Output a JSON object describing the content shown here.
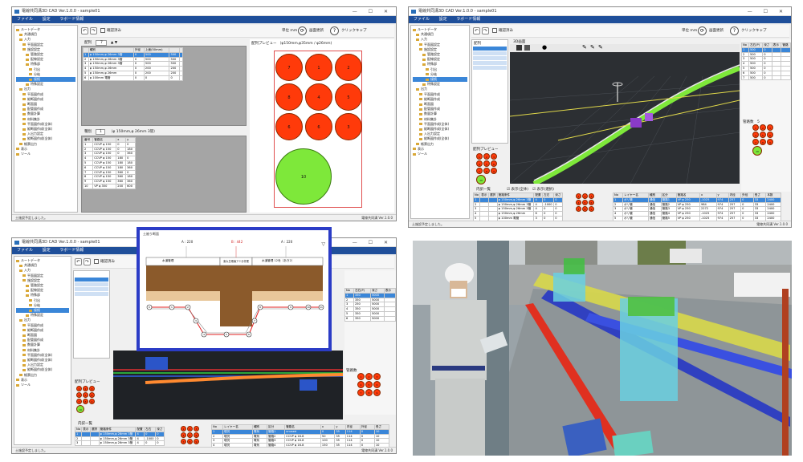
{
  "app": {
    "title": "電線共同溝3D CAD Ver.1.0.0 - sample01",
    "menu": [
      "ファイル",
      "設定",
      "ラボード情報"
    ],
    "status_left": "土施設予定しました。",
    "status_right": "電線共同溝 Ver.1.0.0"
  },
  "toolbar": {
    "checkbox_label": "確認済み",
    "unit_label": "単位 mm",
    "update_label": "画面更新",
    "check_label": "クリックキャプ",
    "prev_icon": "undo-icon",
    "next_icon": "redo-icon"
  },
  "tree": {
    "items": [
      "ルートデータ",
      "共通項目",
      "入力",
      "平面図設定",
      "施設設定",
      "管路設定",
      "配線設定",
      "特殊部",
      "引出",
      "分岐",
      "接続",
      "特殊設定",
      "出力",
      "平面図作成",
      "縦断図作成",
      "断面図",
      "配管図作成",
      "数量計算",
      "材料集計",
      "平面図作成(全体)",
      "縦断図作成(全体)",
      "入出力設定",
      "縦断図作成(全体)",
      "帳票出力",
      "表示",
      "ツール"
    ],
    "selected_index": 10
  },
  "q1": {
    "rack_label": "配列",
    "rack_value": "7",
    "preview_title": "配列プレビュー （φ150mm,φ35mm / φ26mm)",
    "table1_headers": [
      "",
      "種別",
      "外径",
      "上面(50mm)",
      "",
      ""
    ],
    "table1_rows": [
      [
        "1",
        "φ 150mm,φ 26mm 3管",
        "0",
        "500",
        "500",
        ""
      ],
      [
        "2",
        "φ 150mm,φ 26mm 3管",
        "0",
        "500",
        "500",
        ""
      ],
      [
        "3",
        "φ 150mm,φ 26mm 3管",
        "0",
        "500",
        "500",
        ""
      ],
      [
        "4",
        "φ 150mm,φ 26mm",
        "0",
        "200",
        "200",
        ""
      ],
      [
        "5",
        "φ 150mm,φ 26mm",
        "0",
        "200",
        "200",
        ""
      ],
      [
        "6",
        "φ 100mm 電管",
        "0",
        "0",
        "0",
        ""
      ]
    ],
    "sub_label": "種別",
    "sub_value": "1",
    "sub_caption": "（φ 150mm,φ 26mm 3管）",
    "table2_headers": [
      "番号",
      "管路名",
      "x",
      "y"
    ],
    "table2_rows": [
      [
        "1",
        "CCVP φ 150",
        "0",
        "0"
      ],
      [
        "2",
        "CCVP φ 150",
        "0",
        "180"
      ],
      [
        "3",
        "CCVP φ 150",
        "0",
        "360"
      ],
      [
        "4",
        "CCVP φ 150",
        "180",
        "0"
      ],
      [
        "5",
        "CCVP φ 150",
        "180",
        "180"
      ],
      [
        "6",
        "CCVP φ 150",
        "180",
        "360"
      ],
      [
        "7",
        "CCVP φ 150",
        "360",
        "0"
      ],
      [
        "8",
        "CCVP φ 150",
        "360",
        "180"
      ],
      [
        "9",
        "CCVP φ 150",
        "360",
        "360"
      ],
      [
        "10",
        "VP φ 350",
        "200",
        "600"
      ]
    ],
    "circle_labels": [
      "7",
      "1",
      "2",
      "8",
      "4",
      "5",
      "6",
      "6",
      "3"
    ],
    "big_circle_label": "10"
  },
  "q2": {
    "rack_label": "配列",
    "view_label": "3D画面",
    "preview_label": "配列プレビュー",
    "right_headers": [
      "No",
      "左右(P)",
      "深さ",
      "表示",
      "管路"
    ],
    "right_rows": [
      [
        "1",
        "500",
        "0",
        "",
        ""
      ],
      [
        "2",
        "500",
        "0",
        "",
        ""
      ],
      [
        "3",
        "500",
        "0",
        "",
        ""
      ],
      [
        "4",
        "500",
        "0",
        "",
        ""
      ],
      [
        "5",
        "500",
        "0",
        "",
        ""
      ],
      [
        "6",
        "500",
        "0",
        "",
        ""
      ],
      [
        "7",
        "500",
        "0",
        "",
        ""
      ]
    ],
    "check_all": "表示(全体)",
    "check_sel": "表示(選択)",
    "bottom_label": "内訳一覧",
    "bottom_headers": [
      "No",
      "表示",
      "選択",
      "管路条件",
      "配置",
      "左右",
      "深さ"
    ],
    "bottom_rows": [
      [
        "1",
        "",
        "",
        "φ 150mm,φ 26mm 3管",
        "4",
        "0",
        "0"
      ],
      [
        "2",
        "",
        "",
        "φ 150mm,φ 26mm 3管",
        "4",
        "-1000",
        "0"
      ],
      [
        "3",
        "",
        "",
        "φ 150mm,φ 26mm 3管",
        "4",
        "0",
        "0"
      ],
      [
        "4",
        "",
        "",
        "φ 150mm,φ 26mm",
        "6",
        "0",
        "0"
      ],
      [
        "5",
        "",
        "",
        "φ 100mm 電管",
        "3",
        "0",
        "0"
      ]
    ],
    "layer_headers": [
      "No",
      "レイヤー名",
      "種別",
      "区分",
      "管路名",
      "x",
      "y",
      "内径",
      "外径",
      "長さ",
      "本数"
    ],
    "layer_rows": [
      [
        "1",
        "ポリ管",
        "通信",
        "管路1",
        "VP φ 250",
        "-1025",
        "974",
        "257",
        "0",
        "33",
        "2400"
      ],
      [
        "2",
        "ポリ管",
        "通信",
        "管路2",
        "VP φ 250",
        "984",
        "974",
        "257",
        "0",
        "33",
        "2400"
      ],
      [
        "3",
        "ポリ管",
        "通信",
        "管路3",
        "VP φ 250",
        "2272",
        "974",
        "257",
        "0",
        "33",
        "2400"
      ],
      [
        "4",
        "ポリ管",
        "通信",
        "管路4",
        "VP φ 250",
        "-1025",
        "974",
        "257",
        "0",
        "33",
        "2400"
      ],
      [
        "5",
        "ポリ管",
        "通信",
        "管路5",
        "VP φ 250",
        "-1025",
        "974",
        "257",
        "0",
        "33",
        "2400"
      ]
    ],
    "mini_circles": [
      "1",
      "2",
      "3",
      "4",
      "5",
      "6",
      "7",
      "8",
      "9"
    ],
    "mini_big": "10",
    "pipes_label": "管路数",
    "pipes_value": "5"
  },
  "q3": {
    "popup_title": "土被り断面",
    "label_a": "A : 220",
    "label_b": "B : 442",
    "label_c": "A : 220",
    "section_left": "水道管理",
    "section_mid": "東大島電線アミお作業",
    "section_right": "水道管理 12世（あき2）",
    "node_labels": [
      "0",
      "1",
      "2",
      "3",
      "4",
      "5",
      "6",
      "7",
      "8",
      "9",
      "10",
      "11"
    ],
    "left_label": "配列プレビュー",
    "bottom_label": "内訳一覧",
    "right_label": "管路数",
    "layer_headers": [
      "No",
      "レイヤー名",
      "種別",
      "区分",
      "管路名",
      "x",
      "y",
      "内径",
      "外径",
      "長さ"
    ],
    "layer_rows": [
      [
        "1",
        "現況",
        "電気",
        "管路1",
        "unused",
        "0",
        "35",
        "114",
        "0",
        "10"
      ],
      [
        "2",
        "現況",
        "電気",
        "管路2",
        "CCVP φ 16.8",
        "50",
        "35",
        "114",
        "0",
        "10"
      ],
      [
        "3",
        "現況",
        "電気",
        "管路3",
        "CCVP φ 16.8",
        "100",
        "35",
        "114",
        "0",
        "10"
      ],
      [
        "4",
        "現況",
        "電気",
        "管路4",
        "CCVP φ 16.8",
        "150",
        "35",
        "114",
        "0",
        "10"
      ]
    ],
    "right_headers": [
      "No",
      "左右(P)",
      "深さ",
      "表示"
    ],
    "right_rows": [
      [
        "1",
        "350",
        "5000",
        ""
      ],
      [
        "2",
        "350",
        "5000",
        ""
      ],
      [
        "3",
        "250",
        "5000",
        ""
      ],
      [
        "4",
        "350",
        "5000",
        ""
      ],
      [
        "5",
        "350",
        "5000",
        ""
      ],
      [
        "6",
        "350",
        "5000",
        ""
      ]
    ]
  },
  "colors": {
    "accent": "#2b3cc6",
    "menu": "#1f4f9a",
    "pipe_red": "#ff3a0a",
    "pipe_green": "#7ee83a",
    "highlight": "#3a86d8"
  }
}
